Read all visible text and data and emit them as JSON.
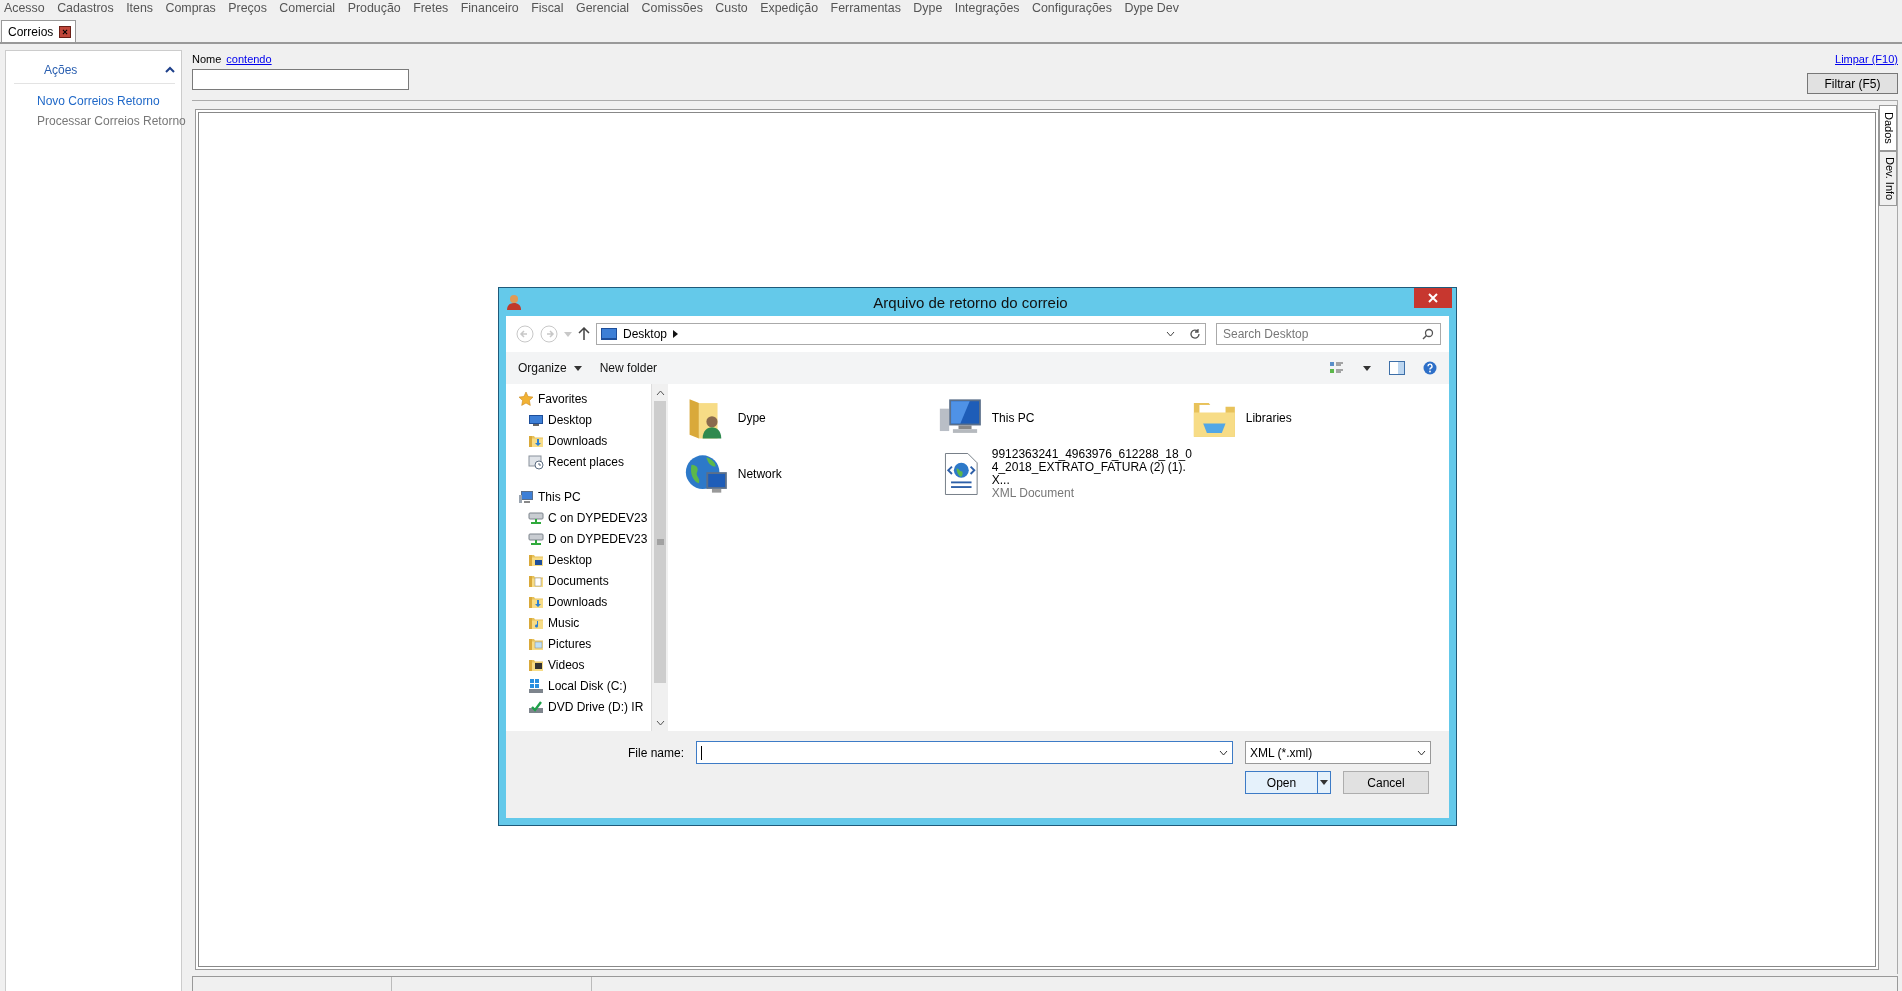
{
  "menu_bar": {
    "items": [
      "Acesso",
      "Cadastros",
      "Itens",
      "Compras",
      "Preços",
      "Comercial",
      "Produção",
      "Fretes",
      "Financeiro",
      "Fiscal",
      "Gerencial",
      "Comissões",
      "Custo",
      "Expedição",
      "Ferramentas",
      "Dype",
      "Integrações",
      "Configurações",
      "Dype Dev"
    ]
  },
  "tabs": [
    {
      "label": "Correios",
      "selected": true
    }
  ],
  "actions_panel": {
    "title": "Ações",
    "expanded": true,
    "items": [
      {
        "label": "Novo Correios Retorno",
        "disabled": false
      },
      {
        "label": "Processar Correios Retorno",
        "disabled": true
      }
    ]
  },
  "filter": {
    "field_label": "Nome",
    "operator": "contendo",
    "clear_link": "Limpar (F10)",
    "filter_button": "Filtrar (F5)"
  },
  "side_tabs": [
    {
      "label": "Dados",
      "selected": true
    },
    {
      "label": "Dev. Info",
      "selected": false
    }
  ],
  "dialog": {
    "title": "Arquivo de retorno do correio",
    "address": {
      "segments": [
        "Desktop"
      ]
    },
    "search": {
      "placeholder": "Search Desktop"
    },
    "toolbar": [
      {
        "label": "Organize",
        "kind": "menu"
      },
      {
        "label": "New folder",
        "kind": "button"
      }
    ],
    "nav_tree": [
      {
        "label": "Favorites",
        "kind": "star",
        "children": [
          {
            "label": "Desktop",
            "kind": "desktop"
          },
          {
            "label": "Downloads",
            "kind": "downloads"
          },
          {
            "label": "Recent places",
            "kind": "recent"
          }
        ]
      },
      {
        "label": "This PC",
        "kind": "computer",
        "children": [
          {
            "label": "C on DYPEDEV23",
            "kind": "network-drive"
          },
          {
            "label": "D on DYPEDEV23",
            "kind": "network-drive"
          },
          {
            "label": "Desktop",
            "kind": "folder-desktop"
          },
          {
            "label": "Documents",
            "kind": "folder-documents"
          },
          {
            "label": "Downloads",
            "kind": "folder-downloads"
          },
          {
            "label": "Music",
            "kind": "folder-music"
          },
          {
            "label": "Pictures",
            "kind": "folder-pictures"
          },
          {
            "label": "Videos",
            "kind": "folder-videos"
          },
          {
            "label": "Local Disk (C:)",
            "kind": "local-disk"
          },
          {
            "label": "DVD Drive (D:) IR",
            "kind": "dvd-drive"
          }
        ]
      }
    ],
    "files": [
      {
        "name": "Dype",
        "kind": "user-folder"
      },
      {
        "name": "This PC",
        "kind": "computer"
      },
      {
        "name": "Libraries",
        "kind": "libraries"
      },
      {
        "name": "Network",
        "kind": "network"
      },
      {
        "name": "9912363241_4963976_612288_18_04_2018_EXTRATO_FATURA (2) (1).X...",
        "type": "XML Document",
        "kind": "xml"
      }
    ],
    "file_name": {
      "label": "File name:"
    },
    "file_type": {
      "value": "XML (*.xml)"
    },
    "buttons": [
      {
        "label": "Open",
        "kind": "split"
      },
      {
        "label": "Cancel",
        "kind": "plain"
      }
    ]
  }
}
